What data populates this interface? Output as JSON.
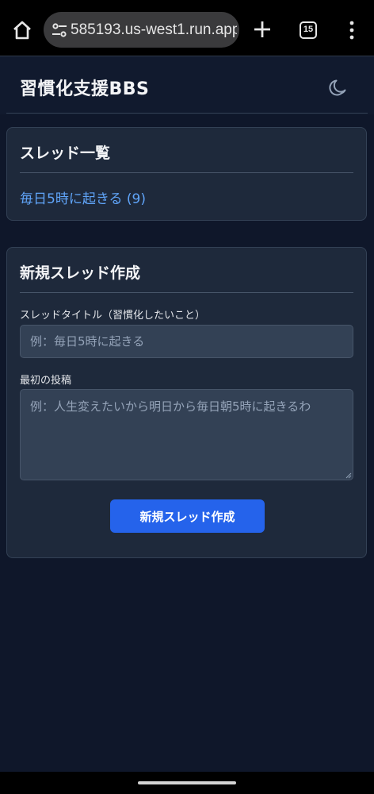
{
  "browser": {
    "url": "585193.us-west1.run.app",
    "tab_count": "15"
  },
  "app": {
    "title": "習慣化支援BBS"
  },
  "thread_list": {
    "heading": "スレッド一覧",
    "threads": [
      {
        "label": "毎日5時に起きる (9)"
      }
    ]
  },
  "new_thread": {
    "heading": "新規スレッド作成",
    "title_label": "スレッドタイトル（習慣化したいこと）",
    "title_placeholder": "例：毎日5時に起きる",
    "title_value": "",
    "post_label": "最初の投稿",
    "post_placeholder": "例：人生変えたいから明日から毎日朝5時に起きるわ",
    "post_value": "",
    "submit_label": "新規スレッド作成"
  },
  "colors": {
    "page_bg": "#0f172a",
    "card_bg": "#1e293b",
    "link": "#60a5fa",
    "primary_button": "#2563eb"
  },
  "icons": {
    "home": "home-icon",
    "site_settings": "tune-icon",
    "new_tab": "plus-icon",
    "tabs": "tab-switcher-icon",
    "menu": "more-vert-icon",
    "theme": "moon-icon"
  }
}
